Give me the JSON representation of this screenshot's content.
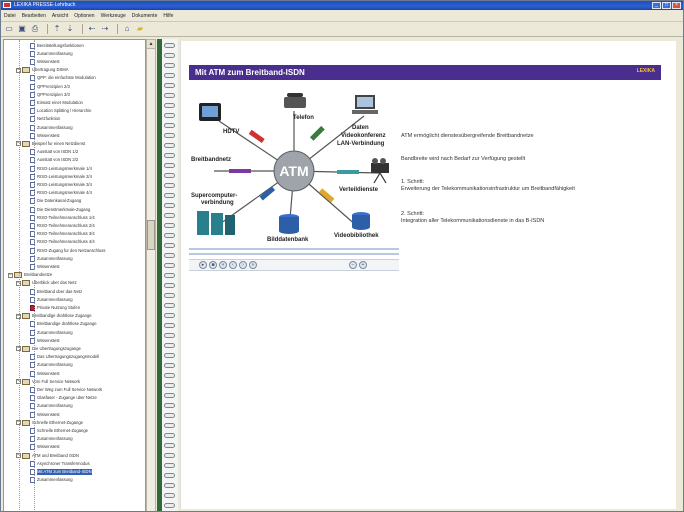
{
  "window": {
    "title": "LEXIKA PRESSE-Lehrbuch"
  },
  "menu": {
    "items": [
      "Datei",
      "Bearbeiten",
      "Ansicht",
      "Optionen",
      "Werkzeuge",
      "Dokumente",
      "Hilfe"
    ]
  },
  "toolbar": {
    "icons": [
      "new-icon",
      "save-icon",
      "print-icon",
      "up-icon",
      "down-icon",
      "back-icon",
      "forward-icon",
      "home-icon",
      "folder-icon"
    ]
  },
  "tree": {
    "items": [
      "Bereitstellungsfunktionen",
      "Zusammenfassung",
      "Wissenstest",
      "Ubertragung DSMA",
      "QPP: die einfachste Modulation",
      "QPPrenzipien 2/3",
      "QPPrenzipien 3/3",
      "Einsatz einer Modulation",
      "Location Splitting / Hierarchie",
      "Netzfunktion",
      "Zusammenfassung",
      "Wissenstest",
      "Beispiel fur einen Netzdienst",
      "Ausstatt von ISDN 1/2",
      "Ausstatt von ISDN 2/2",
      "RISO-Leistungsmerkmale 1/4",
      "RISO-Leistungsmerkmale 2/4",
      "RISO-Leistungsmerkmale 3/4",
      "RISO-Leistungsmerkmale 4/4",
      "Die Datenkanal-Zugang",
      "Die Dienstmerkmale-Zugang",
      "RISO-Teilnehmeranschluss 1/4",
      "RISO-Teilnehmeranschluss 2/4",
      "RISO-Teilnehmeranschluss 3/4",
      "RISO-Teilnehmeranschluss 4/4",
      "RISO-Zugang fur den Netzanschluss",
      "Zusammenfassung",
      "Wissenstest",
      "Breitbandnetze",
      "Uberblick uber das Netz",
      "Breitband uber das Netz",
      "Zusammenfassung",
      "Private Nutzung Stufen",
      "Breitbandige drahtlose Zugange",
      "Breitbandige drahtlose Zugange",
      "Zusammenfassung",
      "Wissenstest",
      "Die Ubertragungszugange",
      "Das Ubertragungszugangsmodell",
      "Zusammenfassung",
      "Wissenstest",
      "Vom Full Service Network",
      "Der Weg zum Full Service Network",
      "Glasfaser - Zugange uber Netze",
      "Zusammenfassung",
      "Wissenstest",
      "Schnelle Ethernet-Zugange",
      "Schnelle Ethernet-Zugange",
      "Zusammenfassung",
      "Wissenstest",
      "ATM und Breitband ISDN",
      "Asynchroner Transfermodus",
      "Mit ATM zum Breitband-ISDN",
      "Zusammenfassung"
    ],
    "selected_index": 52
  },
  "slide": {
    "title": "Mit ATM zum Breitband-ISDN",
    "logo_text": "LEXIKA",
    "diagram": {
      "center": "ATM",
      "labels": {
        "hdtv": "HDTV",
        "telefon": "Telefon",
        "daten": "Daten",
        "videokonferenz": "Videokonferenz",
        "lan": "LAN-Verbindung",
        "breitbandnetz": "Breitbandnetz",
        "verteildienste": "Verteildienste",
        "supercomputer_1": "Supercomputer-",
        "supercomputer_2": "verbindung",
        "bilddatenbank": "Bilddatenbank",
        "videobibliothek": "Videobibliothek"
      }
    },
    "player": {
      "buttons": [
        "play-icon",
        "stop-icon",
        "rewind-icon",
        "step-back-icon",
        "step-forward-icon",
        "fast-forward-icon",
        "volume-down-icon",
        "volume-up-icon"
      ]
    },
    "text": {
      "line1": "ATM ermöglicht dienstesübergreifende Breitbandnetze",
      "line2": "Bandbreite wird nach Bedarf zur Verfügung gestellt",
      "step1_title": "1. Schritt:",
      "step1_text": "Erweiterung der Telekommunikationsinfrastruktur um Breitbandfähigkeit",
      "step2_title": "2. Schritt:",
      "step2_text": "Integration aller Telekommunikationsdienste in das B-ISDN"
    }
  }
}
